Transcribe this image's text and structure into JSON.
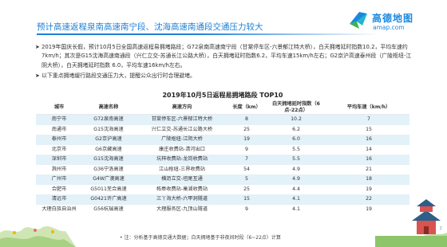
{
  "header": {
    "title": "预计高速返程泉南高速南宁段、沈海高速南通段交通压力较大"
  },
  "logo": {
    "icon": "amap-logo-icon",
    "name_cn": "高德地图",
    "name_en": "amap.com",
    "colors": {
      "blue": "#1a88e0",
      "green": "#3ab54a",
      "teal": "#1fb7c9"
    }
  },
  "bullets": [
    "2019年国庆长假，预计10月5日全国高速返程易拥堵路段；G72泉南高速南宁段（甘棠停车区-六景郁江特大桥），白天拥堵延时指数10.2，平均车速约7km/h；其次是G15沈海高速南通段（兴仁立交-苏通长江公路大桥），白天拥堵延时指数6.2，平均车速15km/h左右；G2京沪高速泰州段（广陵枢纽-江阴大桥），白天拥堵延时指数 6.0，平均车速16km/h左右。",
    "以下重点拥堵缓行路段交通压力大，提醒公众出行时合理避堵。"
  ],
  "table": {
    "title": "2019年10月5日返程易拥堵路段 TOP10",
    "headers": [
      "城市",
      "高速名称",
      "高速方向",
      "长度（km）",
      "白天拥堵延时指数（6点-22点）",
      "平均车速（km/h）"
    ],
    "rows": [
      [
        "南宁市",
        "G72泉南高速",
        "甘棠停车区-六景郁江特大桥",
        "8",
        "10.2",
        "7"
      ],
      [
        "南通市",
        "G15沈海高速",
        "兴仁立交-苏通长江公路大桥",
        "25",
        "6.2",
        "15"
      ],
      [
        "泰州市",
        "G2京沪高速",
        "广陵枢纽-江阴大桥",
        "19",
        "6.0",
        "16"
      ],
      [
        "北京市",
        "G6京藏高速",
        "康庄收费站-清河出口",
        "9",
        "5.5",
        "14"
      ],
      [
        "深圳市",
        "G15沈海高速",
        "坑梓收费站-龙岗收费站",
        "7",
        "5.5",
        "16"
      ],
      [
        "滁州市",
        "G36宁洛高速",
        "江山枢纽-三界收费站",
        "54",
        "4.9",
        "21"
      ],
      [
        "广州市",
        "G4W广澳高速",
        "横沥立交-坦尾互通",
        "5",
        "4.9",
        "18"
      ],
      [
        "合肥市",
        "G5011芜合高速",
        "柘皋收费站-巢湖收费站",
        "25",
        "4.4",
        "19"
      ],
      [
        "清远市",
        "G0421许广高速",
        "三丫海大桥-六甲洞隧道",
        "15",
        "4.1",
        "22"
      ],
      [
        "大理白族自治州",
        "G56杭瑞高速",
        "大理服务区-九顶山隧道",
        "9",
        "4.1",
        "19"
      ]
    ]
  },
  "note": "注：分析基于高德交通大数据；白天拥堵基于非夜间时段（6~22点）计算",
  "page_number": "7"
}
